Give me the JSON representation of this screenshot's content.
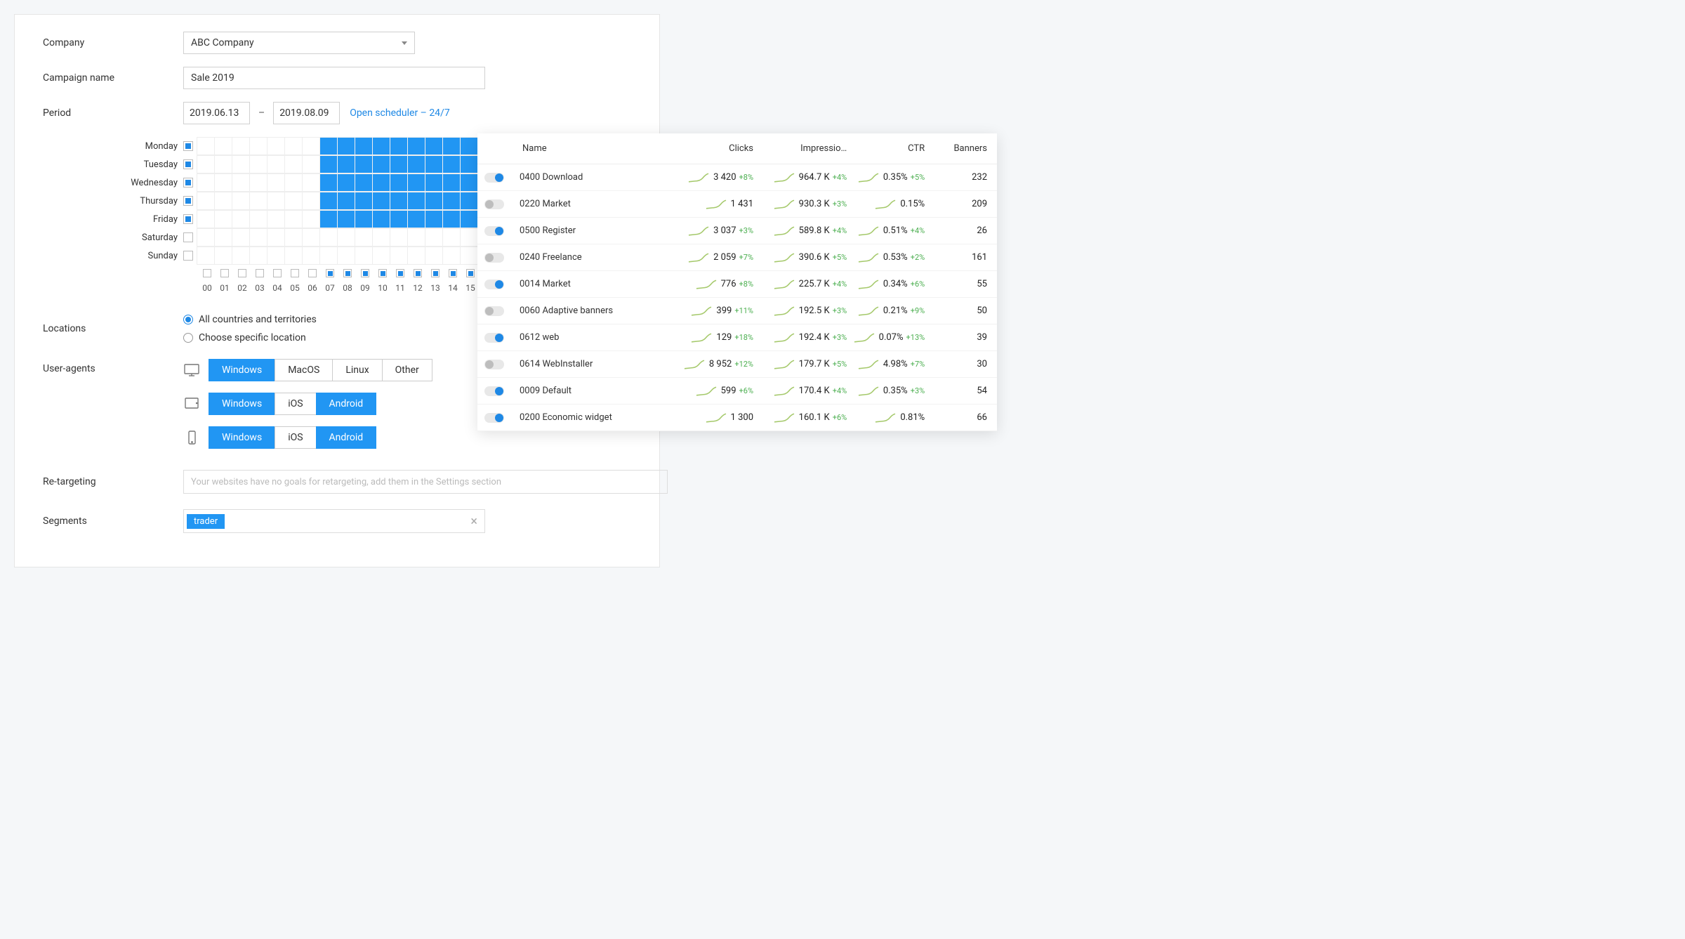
{
  "form": {
    "company_label": "Company",
    "company_value": "ABC Company",
    "campaign_label": "Campaign name",
    "campaign_value": "Sale 2019",
    "period_label": "Period",
    "date_from": "2019.06.13",
    "date_to": "2019.08.09",
    "dash": "–",
    "scheduler_link": "Open scheduler – 24/7",
    "locations_label": "Locations",
    "location_all": "All countries and territories",
    "location_specific": "Choose specific location",
    "ua_label": "User-agents",
    "retarget_label": "Re-targeting",
    "retarget_placeholder": "Your websites have no goals for retargeting, add them in the Settings section",
    "segments_label": "Segments",
    "segment_chip": "trader"
  },
  "schedule": {
    "days": [
      {
        "label": "Monday",
        "checked": true
      },
      {
        "label": "Tuesday",
        "checked": true
      },
      {
        "label": "Wednesday",
        "checked": true
      },
      {
        "label": "Thursday",
        "checked": true
      },
      {
        "label": "Friday",
        "checked": true
      },
      {
        "label": "Saturday",
        "checked": false
      },
      {
        "label": "Sunday",
        "checked": false
      }
    ],
    "hours": [
      "00",
      "01",
      "02",
      "03",
      "04",
      "05",
      "06",
      "07",
      "08",
      "09",
      "10",
      "11",
      "12",
      "13",
      "14",
      "15"
    ],
    "hour_checks": [
      false,
      false,
      false,
      false,
      false,
      false,
      false,
      true,
      true,
      true,
      true,
      true,
      true,
      true,
      true,
      true
    ],
    "active_start": 7,
    "active_end": 19,
    "visible_cols": 24
  },
  "ua": {
    "desktop": [
      {
        "label": "Windows",
        "on": true
      },
      {
        "label": "MacOS",
        "on": false
      },
      {
        "label": "Linux",
        "on": false
      },
      {
        "label": "Other",
        "on": false
      }
    ],
    "tablet": [
      {
        "label": "Windows",
        "on": true
      },
      {
        "label": "iOS",
        "on": false
      },
      {
        "label": "Android",
        "on": true
      }
    ],
    "mobile": [
      {
        "label": "Windows",
        "on": true
      },
      {
        "label": "iOS",
        "on": false
      },
      {
        "label": "Android",
        "on": true
      }
    ]
  },
  "table": {
    "headers": {
      "name": "Name",
      "clicks": "Clicks",
      "impressions": "Impressio…",
      "ctr": "CTR",
      "banners": "Banners"
    },
    "rows": [
      {
        "on": true,
        "name": "0400 Download",
        "clicks": "3 420",
        "clicks_d": "+8%",
        "imp": "964.7 K",
        "imp_d": "+4%",
        "ctr": "0.35%",
        "ctr_d": "+5%",
        "banners": "232"
      },
      {
        "on": false,
        "name": "0220 Market",
        "clicks": "1 431",
        "clicks_d": "",
        "imp": "930.3 K",
        "imp_d": "+3%",
        "ctr": "0.15%",
        "ctr_d": "",
        "banners": "209"
      },
      {
        "on": true,
        "name": "0500 Register",
        "clicks": "3 037",
        "clicks_d": "+3%",
        "imp": "589.8 K",
        "imp_d": "+4%",
        "ctr": "0.51%",
        "ctr_d": "+4%",
        "banners": "26"
      },
      {
        "on": false,
        "name": "0240 Freelance",
        "clicks": "2 059",
        "clicks_d": "+7%",
        "imp": "390.6 K",
        "imp_d": "+5%",
        "ctr": "0.53%",
        "ctr_d": "+2%",
        "banners": "161"
      },
      {
        "on": true,
        "name": "0014 Market",
        "clicks": "776",
        "clicks_d": "+8%",
        "imp": "225.7 K",
        "imp_d": "+4%",
        "ctr": "0.34%",
        "ctr_d": "+6%",
        "banners": "55"
      },
      {
        "on": false,
        "name": "0060 Adaptive banners",
        "clicks": "399",
        "clicks_d": "+11%",
        "imp": "192.5 K",
        "imp_d": "+3%",
        "ctr": "0.21%",
        "ctr_d": "+9%",
        "banners": "50"
      },
      {
        "on": true,
        "name": "0612 web",
        "clicks": "129",
        "clicks_d": "+18%",
        "imp": "192.4 K",
        "imp_d": "+3%",
        "ctr": "0.07%",
        "ctr_d": "+13%",
        "banners": "39"
      },
      {
        "on": false,
        "name": "0614 WebInstaller",
        "clicks": "8 952",
        "clicks_d": "+12%",
        "imp": "179.7 K",
        "imp_d": "+5%",
        "ctr": "4.98%",
        "ctr_d": "+7%",
        "banners": "30"
      },
      {
        "on": true,
        "name": "0009 Default",
        "clicks": "599",
        "clicks_d": "+6%",
        "imp": "170.4 K",
        "imp_d": "+4%",
        "ctr": "0.35%",
        "ctr_d": "+3%",
        "banners": "54"
      },
      {
        "on": true,
        "name": "0200 Economic widget",
        "clicks": "1 300",
        "clicks_d": "",
        "imp": "160.1 K",
        "imp_d": "+6%",
        "ctr": "0.81%",
        "ctr_d": "",
        "banners": "66"
      }
    ]
  }
}
